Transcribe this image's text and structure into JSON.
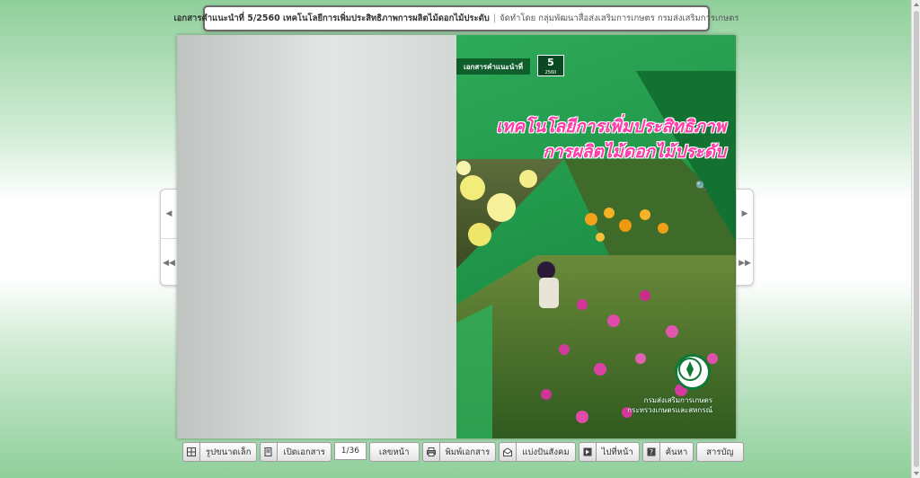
{
  "title_bar": {
    "doc_label": "เอกสารคำแนะนำที่ 5/2560 เทคโนโลยีการเพิ่มประสิทธิภาพการผลิตไม้ดอกไม้ประดับ",
    "separator": "|",
    "publisher": "จัดทำโดย กลุ่มพัฒนาสื่อส่งเสริมการเกษตร กรมส่งเสริมการเกษตร"
  },
  "cover": {
    "series_label": "เอกสารคำแนะนำที่",
    "series_number": "5",
    "series_year": "2560",
    "title_line1": "เทคโนโลยีการเพิ่มประสิทธิภาพ",
    "title_line2": "การผลิตไม้ดอกไม้ประดับ",
    "org_line1": "กรมส่งเสริมการเกษตร",
    "org_line2": "กระทรวงเกษตรและสหกรณ์"
  },
  "toolbar": {
    "thumbnails_label": "รูปขนาดเล็ก",
    "open_doc_label": "เปิดเอกสาร",
    "page_value": "1/36",
    "page_number_label": "เลขหน้า",
    "print_label": "พิมพ์เอกสาร",
    "share_label": "แบ่งปันสังคม",
    "goto_label": "ไปที่หน้า",
    "search_label": "ค้นหา",
    "toc_label": "สารบัญ"
  },
  "icons": {
    "prev": "◀",
    "first": "◀◀",
    "next": "▶",
    "last": "▶▶",
    "zoom": "🔍"
  },
  "colors": {
    "cover_green": "#1f9448",
    "title_pink": "#ff3aa9"
  }
}
